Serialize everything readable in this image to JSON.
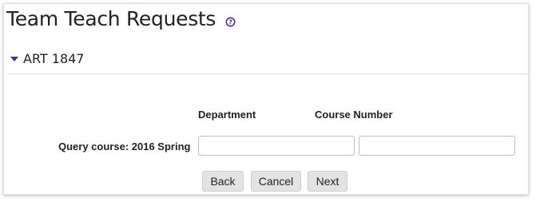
{
  "page": {
    "title": "Team Teach Requests",
    "help_icon": "question-circle-icon",
    "accent_color": "#4b2a82"
  },
  "section": {
    "label": "ART 1847",
    "expanded": true
  },
  "form": {
    "department_header": "Department",
    "course_number_header": "Course Number",
    "query_label": "Query course: 2016 Spring",
    "department_value": "",
    "course_number_value": ""
  },
  "buttons": {
    "back": "Back",
    "cancel": "Cancel",
    "next": "Next"
  }
}
